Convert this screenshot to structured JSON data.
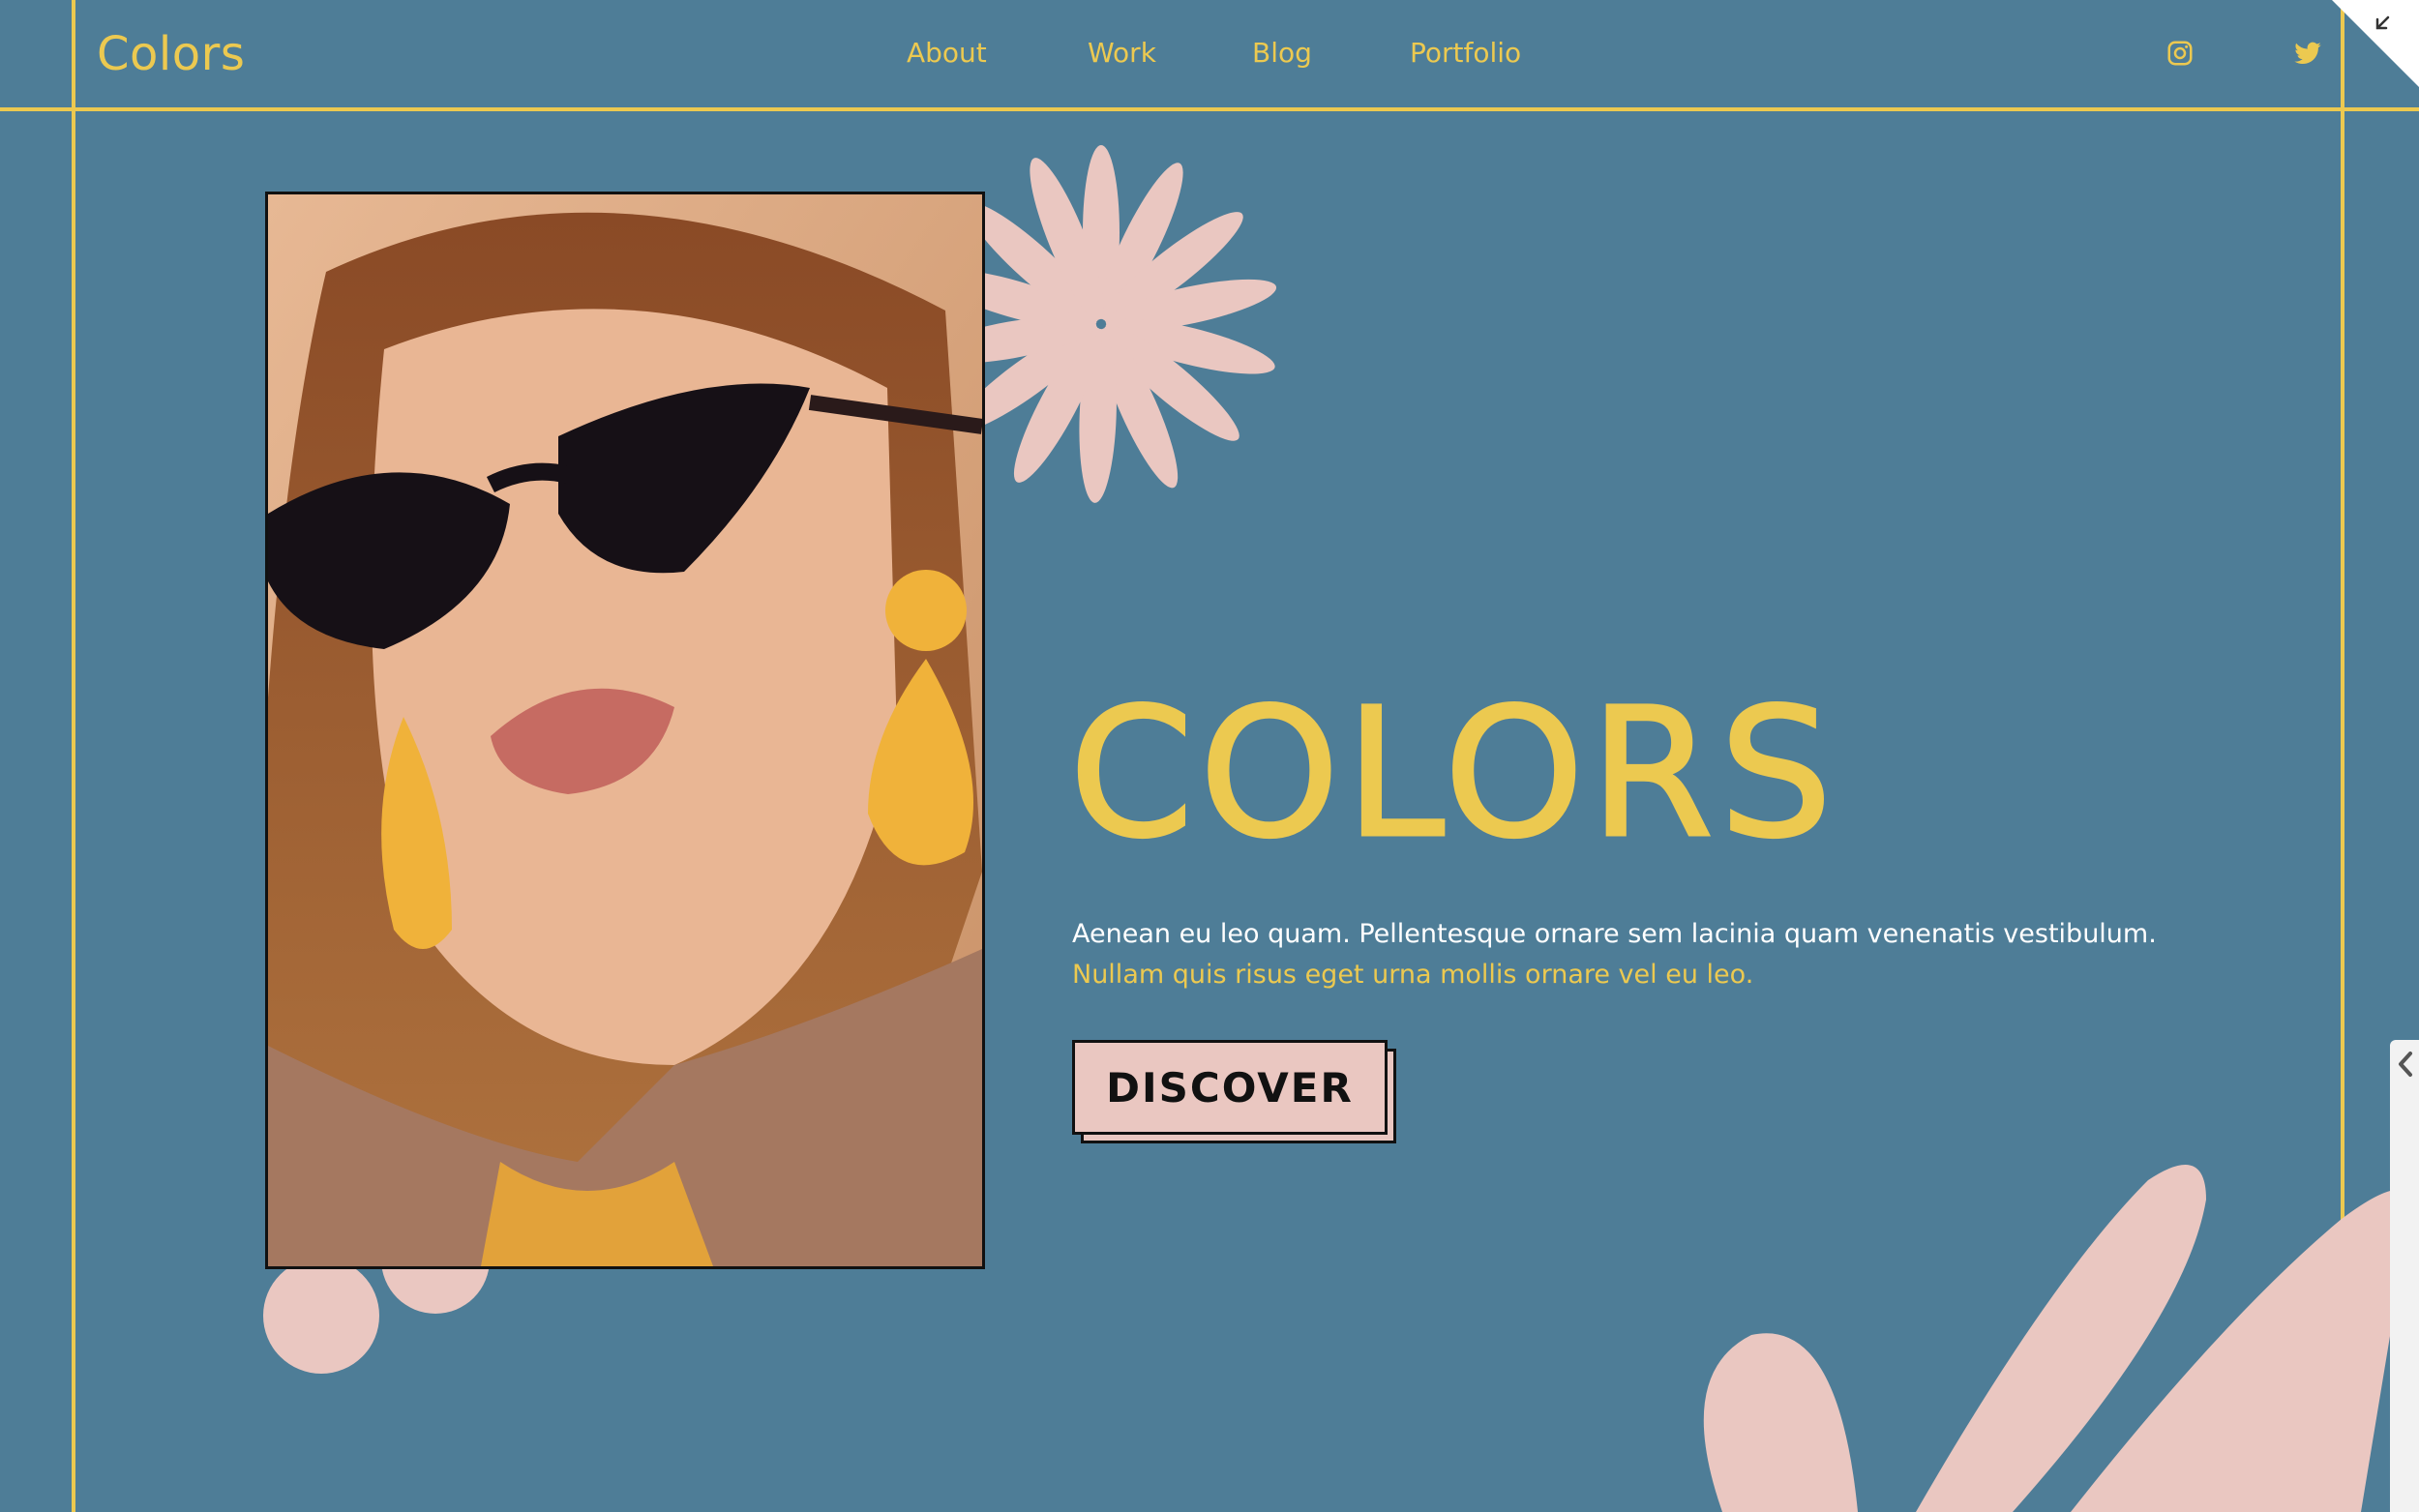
{
  "header": {
    "logo": "Colors",
    "nav": [
      {
        "label": "About"
      },
      {
        "label": "Work"
      },
      {
        "label": "Blog"
      },
      {
        "label": "Portfolio"
      }
    ],
    "social": [
      "instagram-icon",
      "twitter-icon"
    ]
  },
  "hero": {
    "title": "COLORS",
    "line1": "Aenean eu leo quam. Pellentesque ornare sem lacinia quam venenatis vestibulum.",
    "line2": "Nullam quis risus eget urna mollis ornare vel eu leo.",
    "button": "DISCOVER"
  },
  "colors": {
    "background": "#4e7d97",
    "accent": "#ecc950",
    "pink": "#eac7c1",
    "text": "#111111"
  }
}
